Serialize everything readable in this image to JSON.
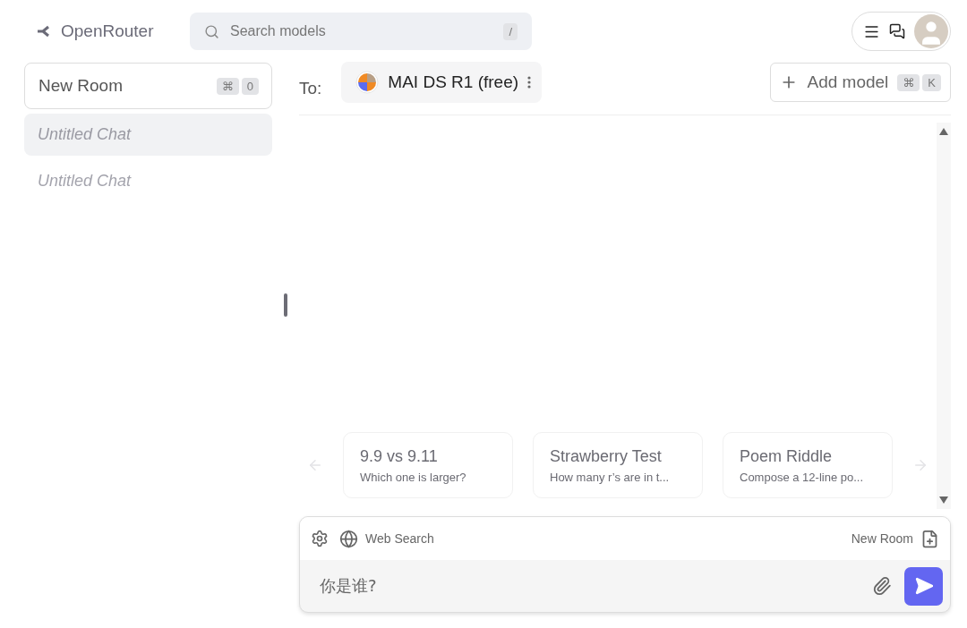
{
  "header": {
    "logo": "OpenRouter",
    "search": {
      "placeholder": "Search models",
      "shortcut": "/"
    }
  },
  "sidebar": {
    "new_room": {
      "label": "New Room",
      "keys": [
        "⌘",
        "0"
      ]
    },
    "chats": [
      {
        "title": "Untitled Chat",
        "selected": true
      },
      {
        "title": "Untitled Chat",
        "selected": false
      }
    ]
  },
  "main": {
    "to_label": "To:",
    "model": "MAI DS R1 (free)",
    "add_model": {
      "label": "Add model",
      "keys": [
        "⌘",
        "K"
      ]
    },
    "suggestions": [
      {
        "title": "9.9 vs 9.11",
        "subtitle": "Which one is larger?"
      },
      {
        "title": "Strawberry Test",
        "subtitle": "How many r’s are in t..."
      },
      {
        "title": "Poem Riddle",
        "subtitle": "Compose a 12-line po..."
      }
    ],
    "composer": {
      "web_search": "Web Search",
      "new_room": "New Room",
      "value": "你是谁?"
    }
  }
}
